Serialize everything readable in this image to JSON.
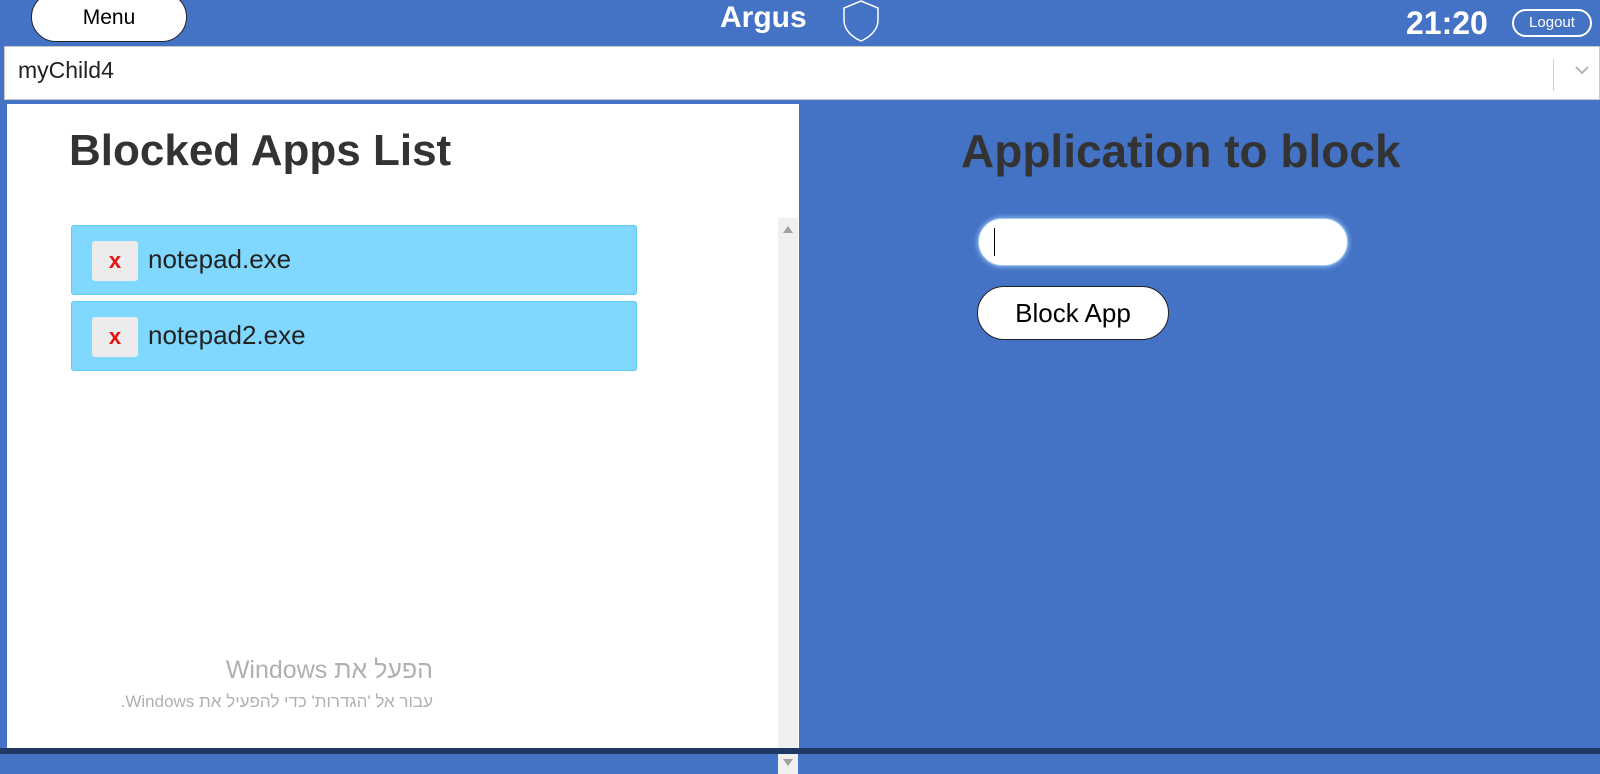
{
  "header": {
    "menu_label": "Menu",
    "app_title": "Argus",
    "clock": "21:20",
    "logout_label": "Logout"
  },
  "child_select": {
    "selected": "myChild4"
  },
  "blocked_list": {
    "title": "Blocked Apps List",
    "items": [
      {
        "remove_label": "x",
        "name": "notepad.exe"
      },
      {
        "remove_label": "x",
        "name": "notepad2.exe"
      }
    ]
  },
  "block_form": {
    "title": "Application to block",
    "input_value": "",
    "button_label": "Block App"
  },
  "watermark": {
    "title": "הפעל את Windows",
    "subtitle": "עבור אל 'הגדרות' כדי להפעיל את Windows."
  },
  "colors": {
    "header_bg": "#4472c4",
    "list_item_bg": "#80d8ff",
    "remove_x": "#e81010"
  }
}
